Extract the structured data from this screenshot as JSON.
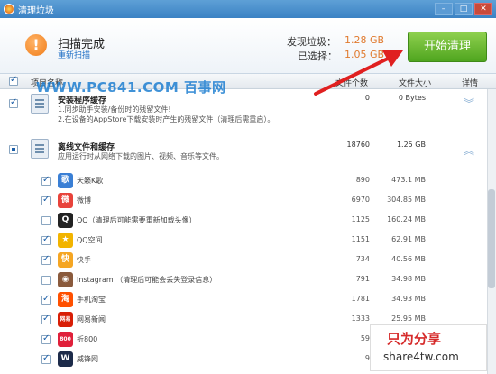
{
  "window": {
    "title": "清理垃圾"
  },
  "header": {
    "status_title": "扫描完成",
    "rescan_link": "重新扫描",
    "found_label": "发现垃圾：",
    "found_value": "1.28 GB",
    "selected_label": "已选择：",
    "selected_value": "1.05 GB",
    "start_button": "开始清理"
  },
  "columns": {
    "name": "项目名称",
    "count": "文件个数",
    "size": "文件大小",
    "detail": "详情"
  },
  "watermark": "WWW.PC841.COM 百事网",
  "groups": [
    {
      "name": "安装程序缓存",
      "desc_lines": [
        "1.同步助手安装/备份时的残留文件!",
        "2.在设备的AppStore下载安装时产生的残留文件（清理后需重启）。"
      ],
      "count": "0",
      "size": "0 Bytes"
    },
    {
      "name": "离线文件和缓存",
      "desc_lines": [
        "应用运行时从网络下载的图片、视频、音乐等文件。"
      ],
      "count": "18760",
      "size": "1.25 GB"
    }
  ],
  "items": [
    {
      "name": "天籁K歌",
      "count": "890",
      "size": "473.1 MB",
      "checked": true,
      "icon": "tianlai-icon",
      "color": "#3a7fd5",
      "glyph": "歌"
    },
    {
      "name": "微博",
      "count": "6970",
      "size": "304.85 MB",
      "checked": true,
      "icon": "weibo-icon",
      "color": "#e8433b",
      "glyph": "微"
    },
    {
      "name": "QQ（清理后可能需要重新加载头像）",
      "count": "1125",
      "size": "160.24 MB",
      "checked": false,
      "icon": "qq-icon",
      "color": "#222222",
      "glyph": "Q"
    },
    {
      "name": "QQ空间",
      "count": "1151",
      "size": "62.91 MB",
      "checked": true,
      "icon": "qzone-icon",
      "color": "#f2b400",
      "glyph": "★"
    },
    {
      "name": "快手",
      "count": "734",
      "size": "40.56 MB",
      "checked": true,
      "icon": "kuaishou-icon",
      "color": "#f5a623",
      "glyph": "快"
    },
    {
      "name": "Instagram （清理后可能会丢失登录信息）",
      "count": "791",
      "size": "34.98 MB",
      "checked": false,
      "icon": "instagram-icon",
      "color": "#8a5a3c",
      "glyph": "◉"
    },
    {
      "name": "手机淘宝",
      "count": "1781",
      "size": "34.93 MB",
      "checked": true,
      "icon": "taobao-icon",
      "color": "#ff5000",
      "glyph": "淘"
    },
    {
      "name": "网易新闻",
      "count": "1333",
      "size": "25.95 MB",
      "checked": true,
      "icon": "netease-news-icon",
      "color": "#d81e06",
      "glyph": "网易"
    },
    {
      "name": "折800",
      "count": "59",
      "size": "",
      "checked": true,
      "icon": "zhe800-icon",
      "color": "#e0203a",
      "glyph": "800"
    },
    {
      "name": "威锋网",
      "count": "9",
      "size": "",
      "checked": true,
      "icon": "weiphone-icon",
      "color": "#1d2b4a",
      "glyph": "W"
    }
  ],
  "promo": {
    "line1": "只为分享",
    "line2": "share4tw.com"
  },
  "colors": {
    "accent_orange": "#e07a2e",
    "start_green": "#5aaf27",
    "arrow_red": "#e02020"
  }
}
